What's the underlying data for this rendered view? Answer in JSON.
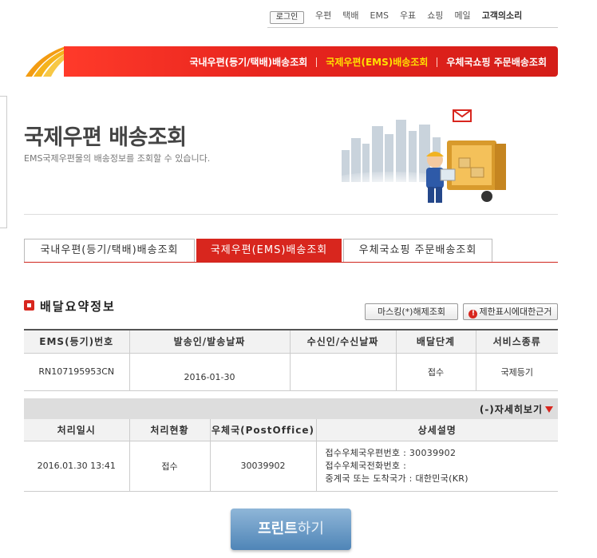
{
  "topnav": {
    "login": "로그인",
    "links": [
      "우편",
      "택배",
      "EMS",
      "우표",
      "쇼핑",
      "메일"
    ],
    "customer_voice": "고객의소리"
  },
  "banner": {
    "items": [
      "국내우편(등기/택배)배송조회",
      "국제우편(EMS)배송조회",
      "우체국쇼핑 주문배송조회"
    ],
    "active_index": 1
  },
  "header": {
    "title": "국제우편 배송조회",
    "subtitle": "EMS국제우편물의 배송정보를 조회할 수 있습니다."
  },
  "tabs": [
    "국내우편(등기/택배)배송조회",
    "국제우편(EMS)배송조회",
    "우체국쇼핑 주문배송조회"
  ],
  "summary": {
    "title": "배달요약정보",
    "mask_button": "마스킹(*)해제조회",
    "limit_button": "제한표시에대한근거",
    "columns": [
      "EMS(등기)번호",
      "발송인/발송날짜",
      "수신인/수신날짜",
      "배달단계",
      "서비스종류"
    ],
    "row": [
      "RN107195953CN",
      "2016-01-30",
      "",
      "접수",
      "국제등기"
    ]
  },
  "detail": {
    "toggle": "(-)자세히보기",
    "columns": [
      "처리일시",
      "처리현황",
      "우체국(PostOffice)",
      "상세설명"
    ],
    "row": {
      "datetime": "2016.01.30 13:41",
      "status": "접수",
      "office": "30039902",
      "desc1": "접수우체국우편번호 : 30039902",
      "desc2": "접수우체국전화번호 :",
      "desc3": "중계국 또는 도착국가 : 대한민국(KR)"
    }
  },
  "print": {
    "bold": "프린트",
    "thin": "하기"
  },
  "colors": {
    "accent": "#d8261e",
    "banner_active": "#ffe000",
    "print_button": "#5a8dbd"
  }
}
